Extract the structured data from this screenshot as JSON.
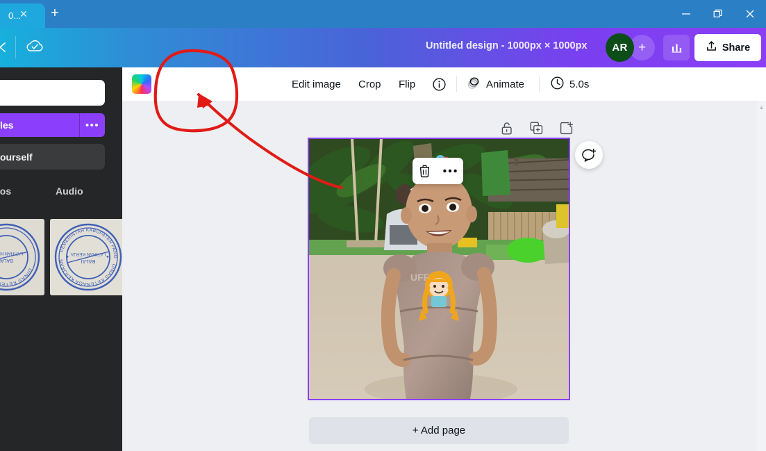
{
  "browser": {
    "tab_title": "0...",
    "tab_close_icon": "close-icon",
    "new_tab_icon": "plus-icon",
    "window_minimize": "minimize-icon",
    "window_maximize": "restore-icon",
    "window_close": "close-icon"
  },
  "appbar": {
    "back_icon": "back-arrow-icon",
    "saved_icon": "cloud-check-icon",
    "doc_title": "Untitled design - 1000px × 1000px",
    "avatar_initials": "AR",
    "avatar_add_label": "+",
    "insights_icon": "bar-chart-icon",
    "share_label": "Share",
    "share_icon": "share-upload-icon",
    "gradient_start": "#17b0dd",
    "gradient_end": "#8b3ff5"
  },
  "sidepanel": {
    "search_value": "",
    "search_placeholder": "",
    "primary_button_label": "les",
    "primary_button_color": "#8b3ffd",
    "primary_more_icon": "more-horizontal-icon",
    "dark_item_label": "ourself",
    "tabs": [
      {
        "label": "eos",
        "name": "videos"
      },
      {
        "label": "Audio",
        "name": "audio"
      }
    ],
    "thumbnails": [
      {
        "name": "stamp-thumbnail-1",
        "alt": "blue circular official stamp"
      },
      {
        "name": "stamp-thumbnail-2",
        "alt": "blue circular official stamp"
      }
    ],
    "stamp_text_outer_top": "DINAS KETENAGA KERJAAN",
    "stamp_text_outer_bottom": "PEMERINTAH KABUPATEN PANGKEP",
    "stamp_text_inner": "BALAI LATIHAN KERJA",
    "collapse_icon": "chevron-left-icon"
  },
  "toolbar": {
    "color_swatch_name": "image-color-swatch",
    "edit_image_label": "Edit image",
    "crop_label": "Crop",
    "flip_label": "Flip",
    "info_icon": "info-icon",
    "animate_label": "Animate",
    "animate_icon": "animate-icon",
    "duration_label": "5.0s",
    "duration_icon": "clock-icon",
    "transparency_icon": "transparency-checker-icon",
    "lock_icon": "lock-icon",
    "delete_icon": "trash-icon"
  },
  "canvas": {
    "page_tools": [
      {
        "name": "unlock-page-icon"
      },
      {
        "name": "duplicate-page-icon"
      },
      {
        "name": "add-page-icon"
      }
    ],
    "selection_color": "#8b3ffd",
    "photo_alt": "Toddler in a dusty pink dress standing on sandy playground ground with banana plants and bamboo fence",
    "context_toolbar": [
      {
        "name": "delete-element-icon"
      },
      {
        "name": "more-options-icon"
      }
    ],
    "comment_icon": "add-comment-icon",
    "add_page_label": "+ Add page",
    "scroll_up_icon": "scroll-up-arrow"
  },
  "annotation": {
    "shape": "hand-drawn-circle",
    "color": "#e01b16",
    "target": "Edit image",
    "arrow": "hand-drawn-arrow"
  }
}
